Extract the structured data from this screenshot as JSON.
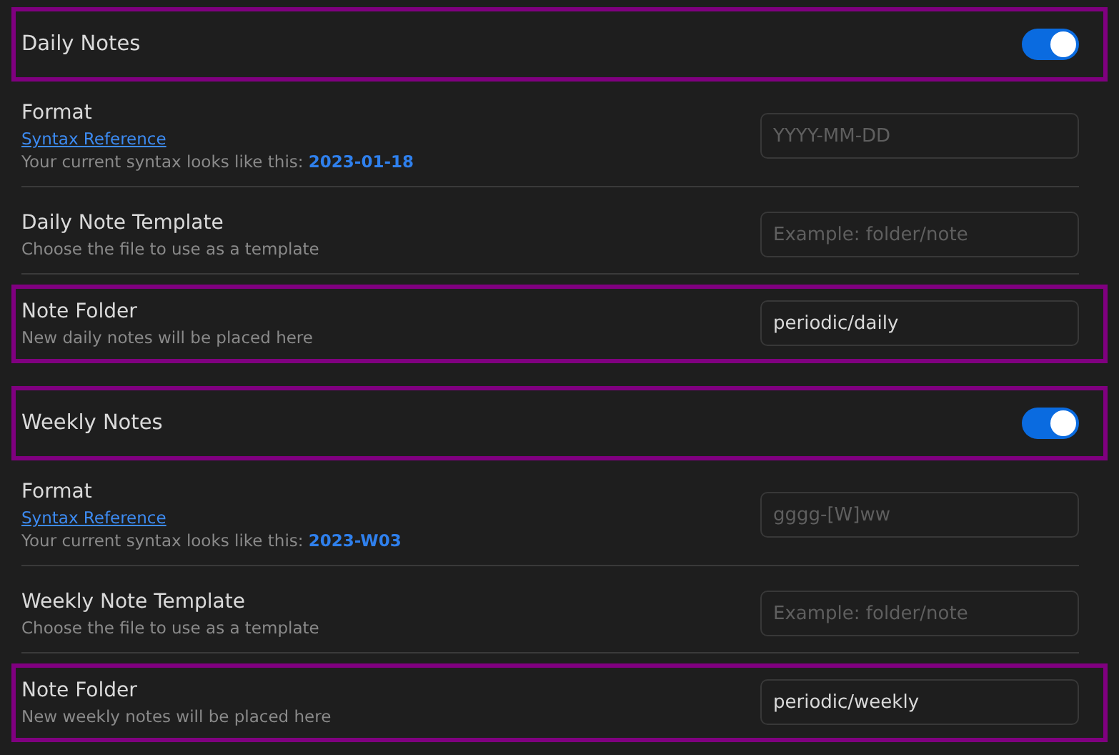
{
  "sections": [
    {
      "title": "Daily Notes",
      "enabled": true,
      "highlighted": true,
      "settings": [
        {
          "name": "Format",
          "link": "Syntax Reference",
          "description": "Your current syntax looks like this: **2023-01-18**",
          "placeholder": "YYYY-MM-DD",
          "highlighted": false
        },
        {
          "name": "Daily Note Template",
          "description": "Choose the file to use as a template",
          "placeholder": "Example: folder/note",
          "highlighted": false
        },
        {
          "name": "Note Folder",
          "description": "New daily notes will be placed here",
          "value": "periodic/daily",
          "highlighted": true
        }
      ]
    },
    {
      "title": "Weekly Notes",
      "enabled": true,
      "highlighted": true,
      "settings": [
        {
          "name": "Format",
          "link": "Syntax Reference",
          "description": "Your current syntax looks like this: **2023-W03**",
          "placeholder": "gggg-[W]ww",
          "highlighted": false
        },
        {
          "name": "Weekly Note Template",
          "description": "Choose the file to use as a template",
          "placeholder": "Example: folder/note",
          "highlighted": false
        },
        {
          "name": "Note Folder",
          "description": "New weekly notes will be placed here",
          "value": "periodic/weekly",
          "highlighted": true
        }
      ]
    }
  ]
}
